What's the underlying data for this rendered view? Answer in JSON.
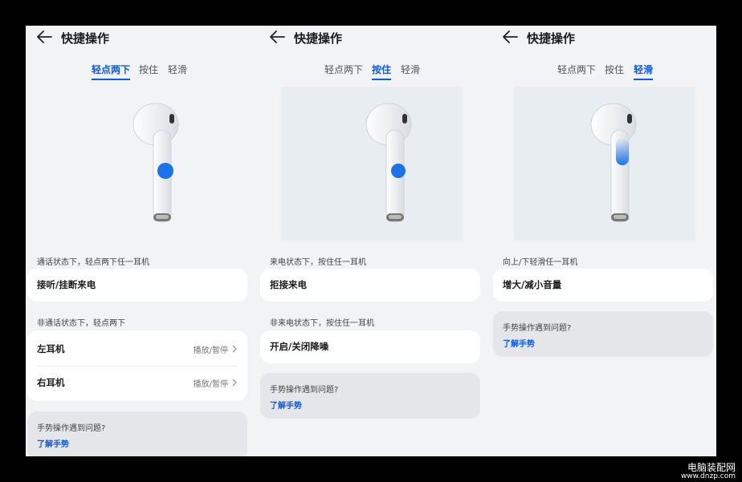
{
  "colors": {
    "accent": "#0a59f7",
    "tap_dot": "#1a73e8",
    "page_bg": "#f1f3f5",
    "card_bg": "#ffffff",
    "help_bg": "#e4e6e9"
  },
  "panels": [
    {
      "title": "快捷操作",
      "tabs": [
        "轻点两下",
        "按住",
        "轻滑"
      ],
      "active_tab": 0,
      "gesture": "double-tap",
      "section1_label": "通话状态下，轻点两下任一耳机",
      "section1_item": "接听/挂断来电",
      "section2_label": "非通话状态下，轻点两下",
      "rows": [
        {
          "label": "左耳机",
          "value": "播放/暂停"
        },
        {
          "label": "右耳机",
          "value": "播放/暂停"
        }
      ],
      "help_question": "手势操作遇到问题?",
      "help_link": "了解手势"
    },
    {
      "title": "快捷操作",
      "tabs": [
        "轻点两下",
        "按住",
        "轻滑"
      ],
      "active_tab": 1,
      "gesture": "press-hold",
      "section1_label": "来电状态下，按住任一耳机",
      "section1_item": "拒接来电",
      "section2_label": "非来电状态下，按住任一耳机",
      "section2_item": "开启/关闭降噪",
      "help_question": "手势操作遇到问题?",
      "help_link": "了解手势"
    },
    {
      "title": "快捷操作",
      "tabs": [
        "轻点两下",
        "按住",
        "轻滑"
      ],
      "active_tab": 2,
      "gesture": "swipe",
      "section1_label": "向上/下轻滑任一耳机",
      "section1_item": "增大/减小音量",
      "help_question": "手势操作遇到问题?",
      "help_link": "了解手势"
    }
  ],
  "watermark": {
    "line1": "电脑装配网",
    "line2": "www.dnzp.com"
  }
}
